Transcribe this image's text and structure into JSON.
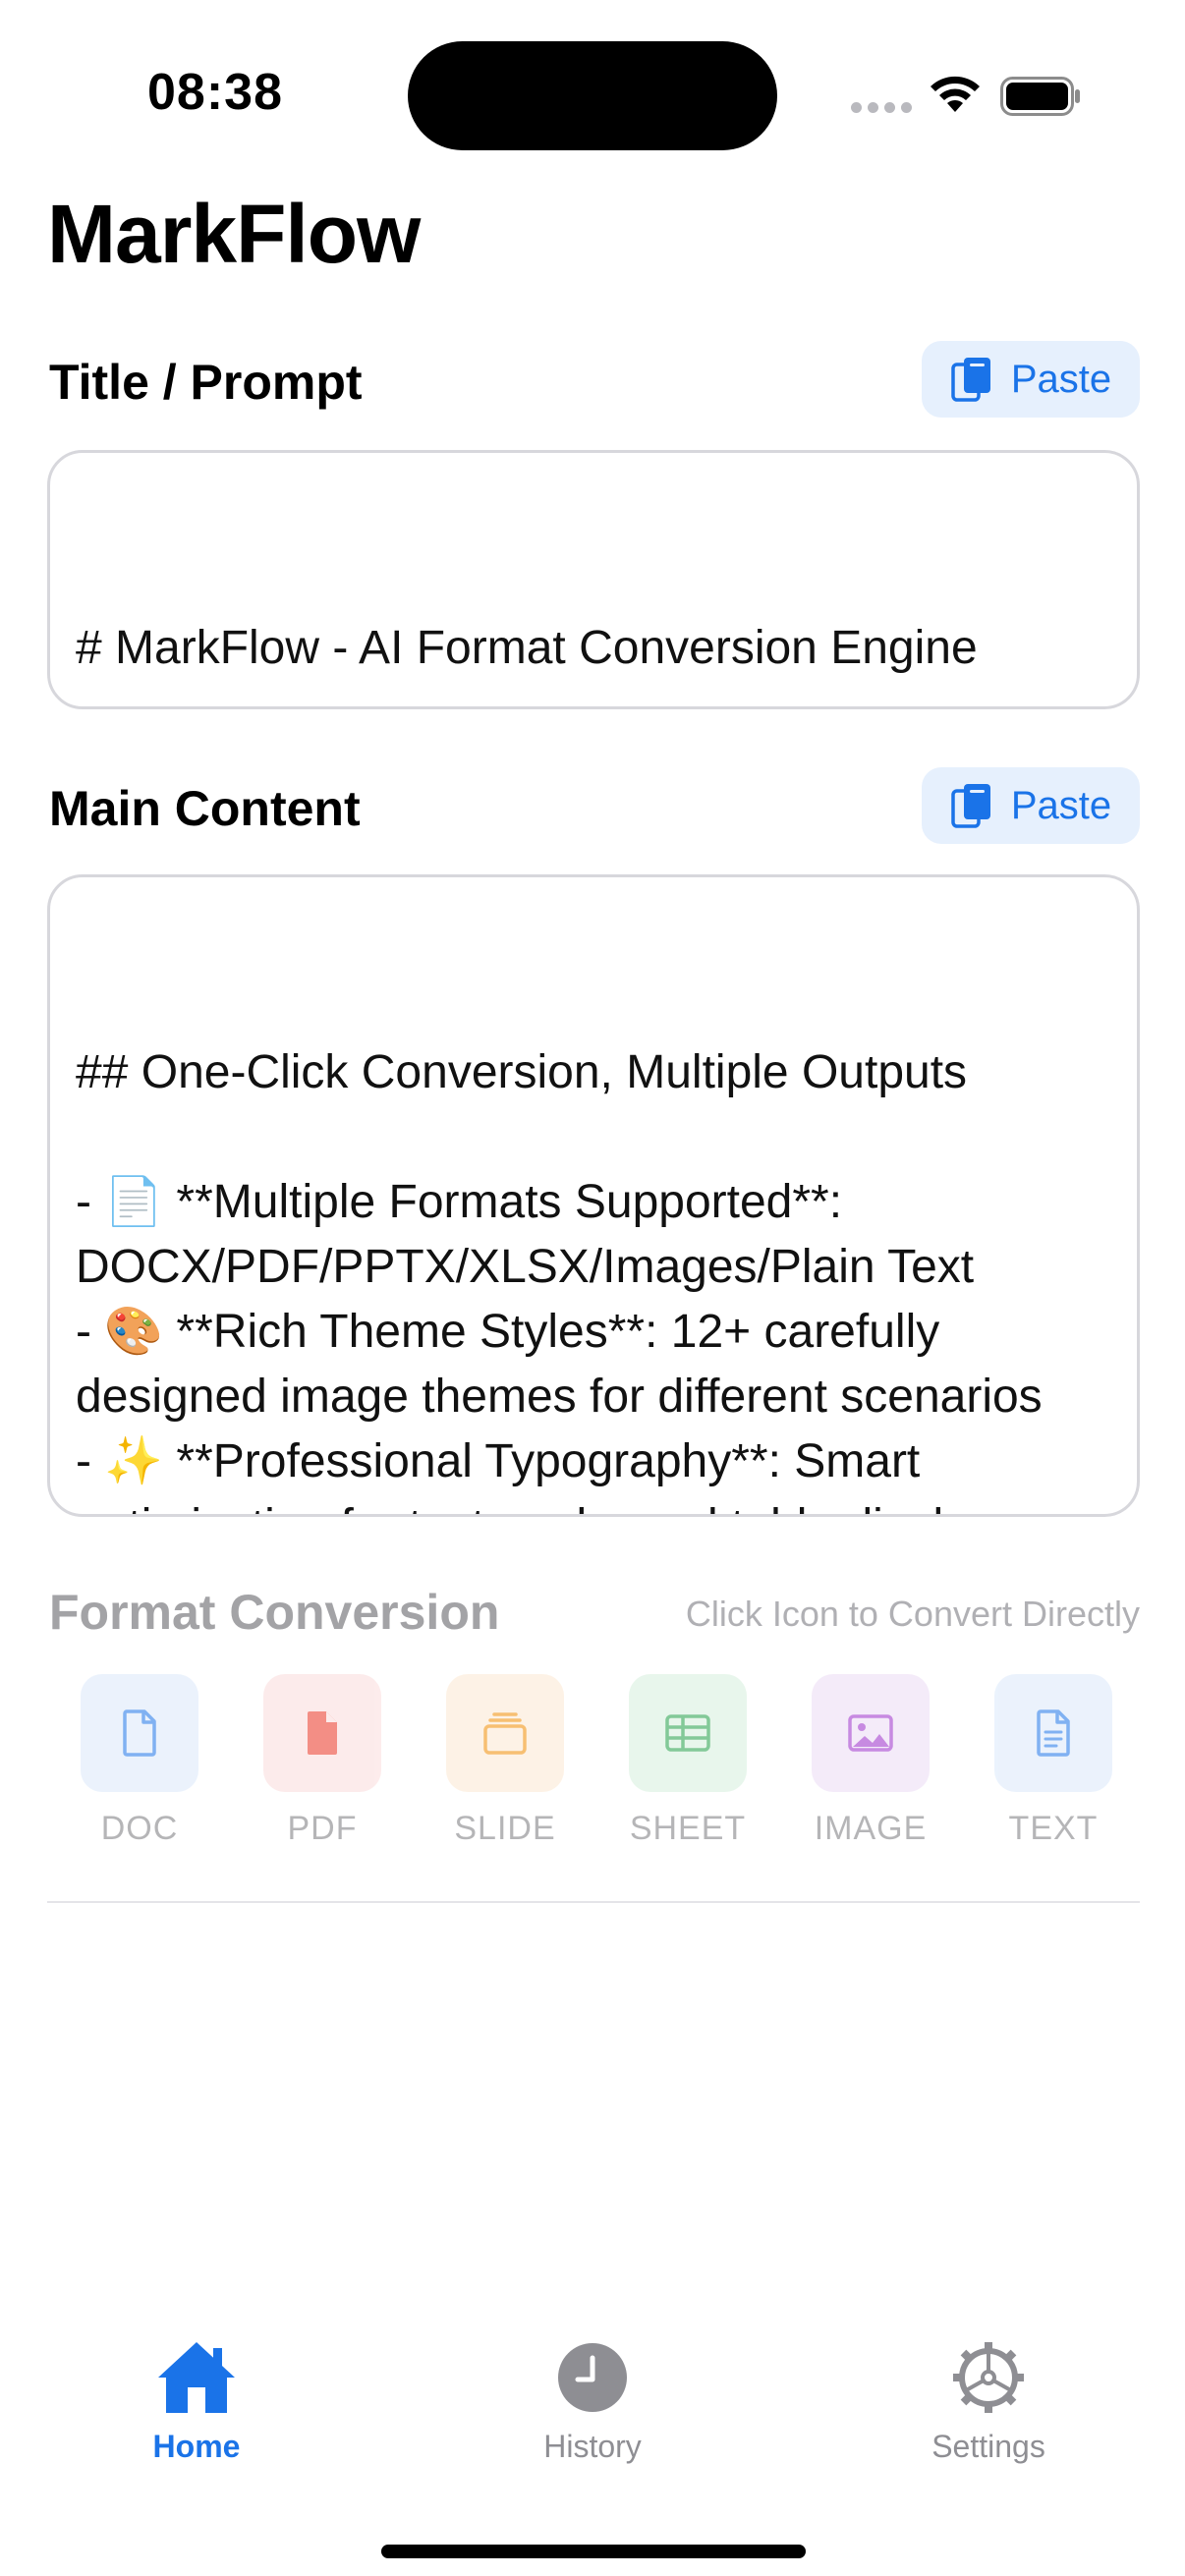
{
  "status": {
    "time": "08:38"
  },
  "app": {
    "title": "MarkFlow"
  },
  "title_section": {
    "label": "Title / Prompt",
    "paste_label": "Paste",
    "value": "# MarkFlow - AI Format Conversion Engine"
  },
  "content_section": {
    "label": "Main Content",
    "paste_label": "Paste",
    "value": "## One-Click Conversion, Multiple Outputs\n\n- 📄 **Multiple Formats Supported**: DOCX/PDF/PPTX/XLSX/Images/Plain Text\n- 🎨 **Rich Theme Styles**: 12+ carefully designed image themes for different scenarios\n- ✨ **Professional Typography**: Smart optimization for text, code, and table display\n- 🖼️ **Beautiful Image Generation**: Polished"
  },
  "format_conversion": {
    "title": "Format Conversion",
    "hint": "Click Icon to Convert Directly",
    "formats": [
      {
        "label": "DOC",
        "icon": "doc-icon",
        "color": "#1a73e8",
        "bg": "#dbe9fb"
      },
      {
        "label": "PDF",
        "icon": "pdf-icon",
        "color": "#ea3323",
        "bg": "#fbdcdc"
      },
      {
        "label": "SLIDE",
        "icon": "slide-icon",
        "color": "#f28b00",
        "bg": "#fde8d2"
      },
      {
        "label": "SHEET",
        "icon": "sheet-icon",
        "color": "#1e9e45",
        "bg": "#d6f0dd"
      },
      {
        "label": "IMAGE",
        "icon": "image-icon",
        "color": "#9b2bc9",
        "bg": "#ecdcf5"
      },
      {
        "label": "TEXT",
        "icon": "text-icon",
        "color": "#1a73e8",
        "bg": "#dbe9fb"
      }
    ]
  },
  "tabbar": {
    "items": [
      {
        "label": "Home",
        "icon": "home-icon",
        "active": true
      },
      {
        "label": "History",
        "icon": "clock-icon",
        "active": false
      },
      {
        "label": "Settings",
        "icon": "gear-icon",
        "active": false
      }
    ]
  },
  "colors": {
    "accent": "#1a73e8",
    "inactive": "#8e8e93"
  }
}
